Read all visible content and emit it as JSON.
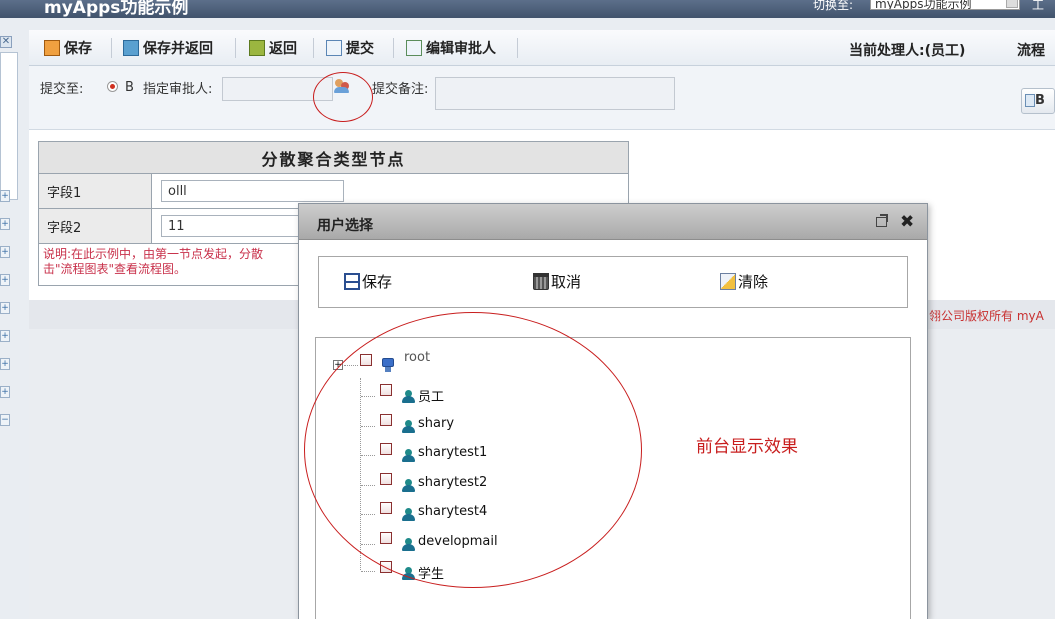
{
  "topbar": {
    "app_title": "myApps功能示例",
    "switch_label": "切换至:",
    "app_select_value": "myApps功能示例",
    "top_link": "工"
  },
  "leftbar": {
    "close_glyph": "✕"
  },
  "toolbar": {
    "save": "保存",
    "save_return": "保存并返回",
    "return": "返回",
    "submit": "提交",
    "edit_approver": "编辑审批人",
    "current_handler": "当前处理人:(员工)",
    "flow_text": "流程"
  },
  "submit_row": {
    "submit_to_label": "提交至:",
    "radio_option": "B",
    "approver_label": "指定审批人:",
    "approver_value": "",
    "note_label": "提交备注:",
    "note_value": "",
    "right_button_label": "B"
  },
  "form": {
    "title": "分散聚合类型节点",
    "fields": [
      {
        "label": "字段1",
        "value": "olll"
      },
      {
        "label": "字段2",
        "value": "11"
      }
    ],
    "note": "说明:在此示例中，由第一节点发起，分散",
    "note_line2": "击\"流程图表\"查看流程图。"
  },
  "footer": {
    "copyright": "翎公司版权所有 myA"
  },
  "dialog": {
    "title": "用户选择",
    "save": "保存",
    "cancel": "取消",
    "clear": "清除",
    "tree": {
      "root": "root",
      "users": [
        "员工",
        "shary",
        "sharytest1",
        "sharytest2",
        "sharytest4",
        "developmail",
        "学生"
      ]
    }
  },
  "annotation": {
    "text": "前台显示效果",
    "color": "#c81e1e"
  }
}
